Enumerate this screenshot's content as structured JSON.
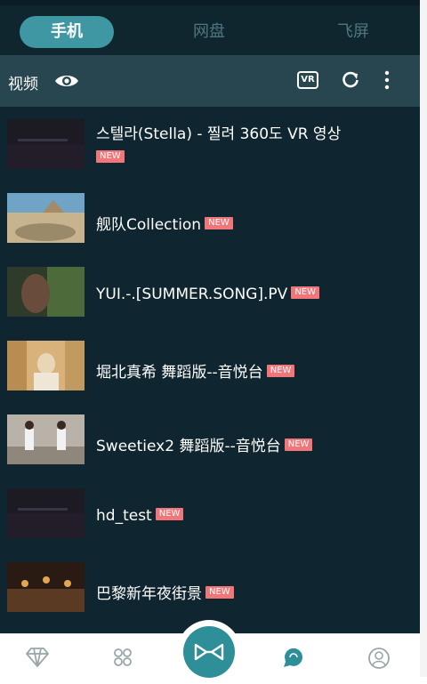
{
  "tabs": [
    {
      "label": "手机",
      "active": true
    },
    {
      "label": "网盘",
      "active": false
    },
    {
      "label": "飞屏",
      "active": false
    }
  ],
  "toolbar": {
    "label": "视频",
    "vr_label": "VR"
  },
  "badge_text": "NEW",
  "items": [
    {
      "title": "스텔라(Stella) - 찔려 360도 VR 영상"
    },
    {
      "title": "舰队Collection"
    },
    {
      "title": "YUI.-.[SUMMER.SONG].PV"
    },
    {
      "title": "堀北真希 舞蹈版--音悦台"
    },
    {
      "title": "Sweetiex2 舞蹈版--音悦台"
    },
    {
      "title": "hd_test"
    },
    {
      "title": "巴黎新年夜街景"
    }
  ],
  "colors": {
    "accent": "#3e97a2",
    "badge": "#f0767a",
    "background": "#0f2530"
  },
  "icons": [
    "eye-icon",
    "vr-icon",
    "refresh-icon",
    "more-icon",
    "diamond-icon",
    "apps-icon",
    "vr-glasses-icon",
    "chat-icon",
    "user-icon"
  ]
}
